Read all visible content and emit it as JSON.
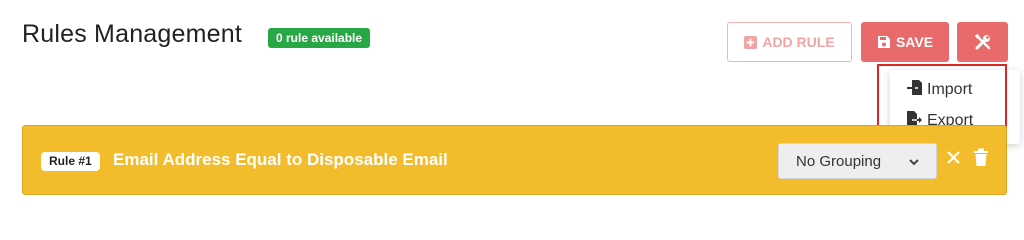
{
  "header": {
    "title": "Rules Management",
    "badge": "0 rule available"
  },
  "toolbar": {
    "add_label": "ADD RULE",
    "save_label": "SAVE"
  },
  "tools_menu": {
    "items": [
      {
        "label": "Import",
        "icon": "file-import-icon"
      },
      {
        "label": "Export",
        "icon": "file-export-icon"
      }
    ]
  },
  "rule": {
    "tag": "Rule #1",
    "title": "Email Address Equal to Disposable Email",
    "grouping": "No Grouping"
  },
  "colors": {
    "primary": "#e86a6a",
    "success_badge": "#28a745",
    "rule_bar": "#f2bc2d",
    "highlight": "#e02424"
  }
}
